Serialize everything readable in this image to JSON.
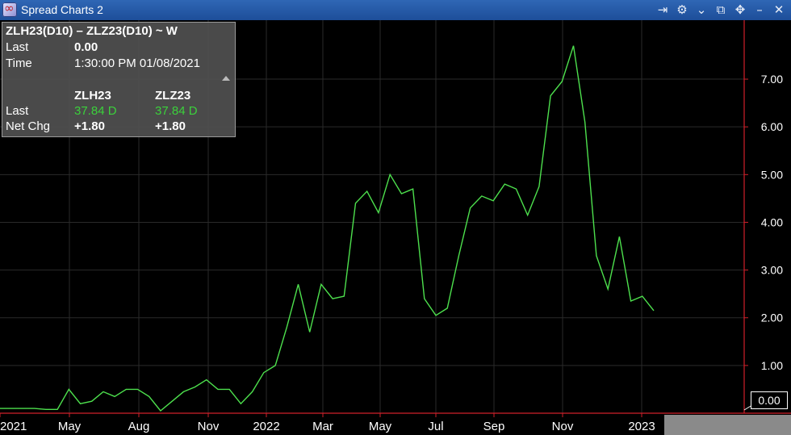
{
  "window": {
    "title": "Spread Charts 2"
  },
  "toolbar": {
    "icons": [
      "export-icon",
      "gear-icon",
      "chevron-down-icon",
      "restore-icon",
      "move-icon",
      "minimize-icon",
      "close-icon"
    ]
  },
  "tooltip": {
    "heading": "ZLH23(D10) – ZLZ23(D10) ~ W",
    "last_label": "Last",
    "last_value": "0.00",
    "time_label": "Time",
    "time_value": "1:30:00 PM  01/08/2021",
    "col1": "ZLH23",
    "col2": "ZLZ23",
    "row_last_label": "Last",
    "row_last_col1": "37.84 D",
    "row_last_col2": "37.84 D",
    "row_netchg_label": "Net Chg",
    "row_netchg_col1": "+1.80",
    "row_netchg_col2": "+1.80"
  },
  "last_price_label": "0.00",
  "colors": {
    "line": "#4de04d",
    "axis": "#d0202a",
    "grid": "#2a2a2a",
    "positive": "#3bd13b"
  },
  "chart_data": {
    "type": "line",
    "series": [
      {
        "name": "ZLH23(D10) – ZLZ23(D10)",
        "values": [
          0.1,
          0.1,
          0.1,
          0.1,
          0.08,
          0.08,
          0.5,
          0.2,
          0.25,
          0.45,
          0.35,
          0.5,
          0.5,
          0.35,
          0.05,
          0.25,
          0.45,
          0.55,
          0.7,
          0.5,
          0.5,
          0.2,
          0.45,
          0.85,
          1.0,
          1.8,
          2.7,
          1.7,
          2.7,
          2.4,
          2.45,
          4.4,
          4.65,
          4.2,
          5.0,
          4.6,
          4.7,
          2.4,
          2.05,
          2.2,
          3.3,
          4.3,
          4.55,
          4.45,
          4.8,
          4.7,
          4.15,
          4.75,
          6.65,
          6.95,
          7.7,
          6.1,
          3.3,
          2.6,
          3.7,
          2.35,
          2.45,
          2.15
        ]
      },
      {
        "name": "last",
        "values": [
          0.0
        ]
      }
    ],
    "x_tick_labels": [
      "2021",
      "May",
      "Aug",
      "Nov",
      "2022",
      "Mar",
      "May",
      "Jul",
      "Sep",
      "Nov",
      "2023"
    ],
    "y_tick_labels": [
      "1.00",
      "2.00",
      "3.00",
      "4.00",
      "5.00",
      "6.00",
      "7.00"
    ],
    "y_ticks": [
      1,
      2,
      3,
      4,
      5,
      6,
      7
    ],
    "ylim": [
      0,
      8.1
    ],
    "grid": true
  }
}
